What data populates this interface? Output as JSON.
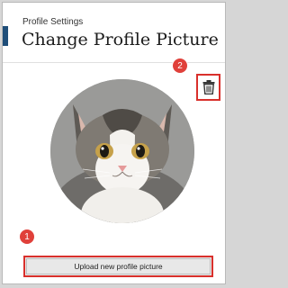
{
  "header": {
    "breadcrumb": "Profile Settings",
    "title": "Change Profile Picture"
  },
  "profile_picture": {
    "alt": "Profile picture of a cat"
  },
  "actions": {
    "upload_label": "Upload new profile picture",
    "delete_icon": "trash-icon"
  },
  "callouts": {
    "upload": "1",
    "delete": "2"
  },
  "colors": {
    "accent_red": "#d9302c",
    "callout_red": "#e0403a",
    "nav_tab": "#1f4e79"
  }
}
